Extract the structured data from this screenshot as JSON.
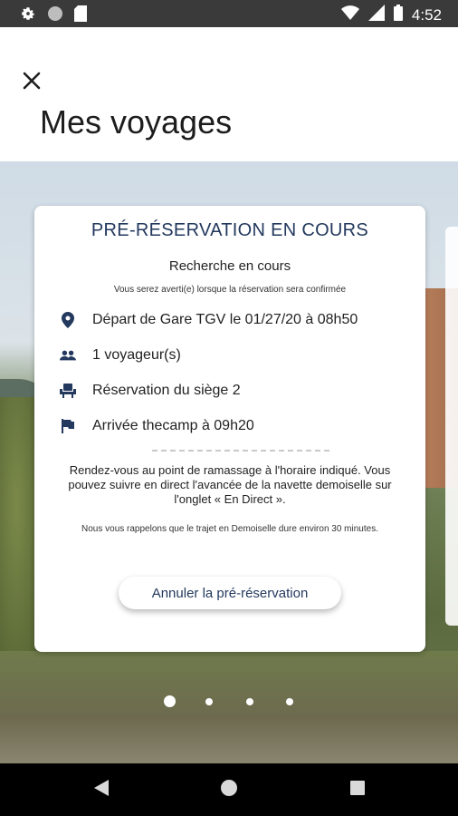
{
  "status_bar": {
    "time": "4:52",
    "icons": [
      "settings-icon",
      "circle-icon",
      "sim-card-icon",
      "wifi-icon",
      "signal-icon",
      "battery-icon"
    ]
  },
  "header": {
    "title": "Mes voyages",
    "close_icon": "close-icon"
  },
  "card": {
    "title": "PRÉ-RÉSERVATION EN COURS",
    "subtitle": "Recherche en cours",
    "note": "Vous serez averti(e) lorsque la réservation sera confirmée",
    "rows": [
      {
        "icon": "location-pin-icon",
        "text": "Départ de Gare TGV le 01/27/20 à 08h50"
      },
      {
        "icon": "people-icon",
        "text": "1 voyageur(s)"
      },
      {
        "icon": "seat-icon",
        "text": "Réservation du siège 2"
      },
      {
        "icon": "flag-icon",
        "text": "Arrivée thecamp à 09h20"
      }
    ],
    "rdv_text": "Rendez-vous au point de ramassage à l'horaire indiqué. Vous pouvez suivre en direct l'avancée de la navette demoiselle sur l'onglet « En Direct ».",
    "reminder": "Nous vous rappelons que le trajet en Demoiselle dure environ 30 minutes.",
    "cancel_label": "Annuler la pré-réservation"
  },
  "pager": {
    "count": 4,
    "active_index": 0
  },
  "nav": {
    "icons": [
      "back-icon",
      "home-icon",
      "recents-icon"
    ]
  },
  "colors": {
    "accent": "#23395d",
    "status_bar": "#3a3a3a",
    "nav_bar": "#000000"
  }
}
